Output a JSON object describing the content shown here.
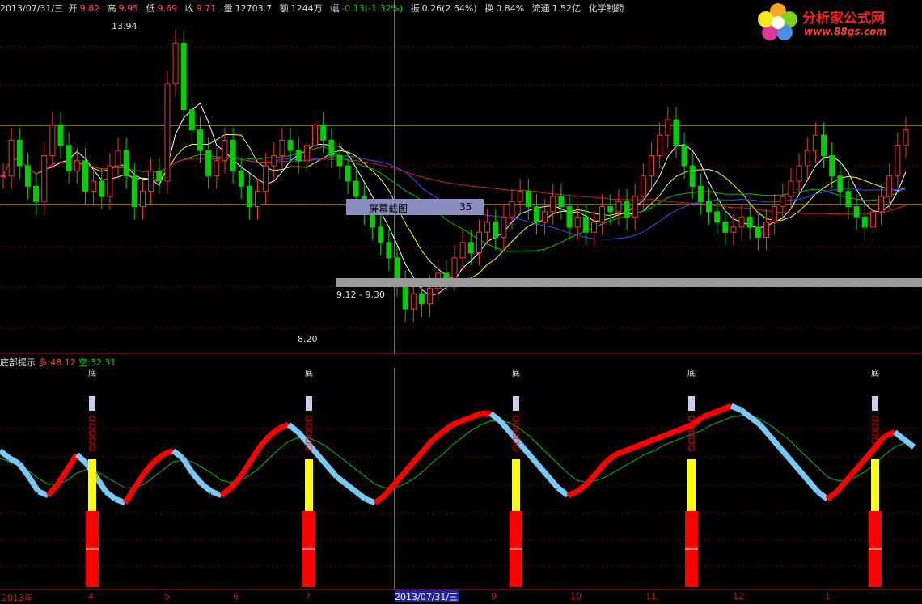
{
  "header": {
    "date": "2013/07/31/三",
    "open_label": "开",
    "open": "9.82",
    "high_label": "高",
    "high": "9.95",
    "low_label": "低",
    "low": "9.69",
    "close_label": "收",
    "close": "9.71",
    "vol_label": "量",
    "vol": "12703.7",
    "amt_label": "额",
    "amt": "1244万",
    "chg_label": "幅",
    "chg": "-0.13(-1.32%)",
    "amp_label": "振",
    "amp": "0.26(2.64%)",
    "turn_label": "换",
    "turn": "0.84%",
    "float_label": "流通",
    "float": "1.52亿",
    "sector": "化学制药"
  },
  "logo": {
    "title": "分析家公式网",
    "url": "www.88gs.com"
  },
  "tooltip": {
    "label": "屏幕截图",
    "value": "35"
  },
  "indicator": {
    "name": "底部提示",
    "long_label": "多:",
    "long_value": "48.12",
    "short_label": "空:",
    "short_value": "32.31",
    "marker": "底"
  },
  "colors": {
    "up": "#ff3232",
    "down": "#00d000",
    "ma5": "#ffffff",
    "ma10": "#ffff00",
    "ma20": "#00c000",
    "ma30": "#3050ff",
    "ma60": "#d02020",
    "rise": "#ff0000",
    "fall": "#7ac8f5",
    "signal": "#00c000",
    "yellow": "#ffff00",
    "grid": "#800000"
  },
  "chart_data": {
    "type": "candlestick",
    "ylim": [
      8.0,
      14.2
    ],
    "annotations": [
      {
        "text": "13.94",
        "value": 13.94
      },
      {
        "text": "8.20",
        "value": 8.2
      },
      {
        "text": "9.12 - 9.30",
        "value": 9.3
      }
    ],
    "x_ticks": [
      "2013年",
      "4",
      "5",
      "6",
      "7",
      "2013/07/31/三",
      "9",
      "10",
      "11",
      "12",
      "1"
    ],
    "candle_closes": [
      11.2,
      11.9,
      11.4,
      11.0,
      10.7,
      11.6,
      12.2,
      11.8,
      11.3,
      11.5,
      10.9,
      11.1,
      10.8,
      11.4,
      11.7,
      11.2,
      10.6,
      10.9,
      11.3,
      11.1,
      13.0,
      13.8,
      12.5,
      12.1,
      11.7,
      11.2,
      11.5,
      11.9,
      11.3,
      11.0,
      10.6,
      10.9,
      11.4,
      11.6,
      11.9,
      11.7,
      11.5,
      11.8,
      12.2,
      11.9,
      11.6,
      11.4,
      11.1,
      10.8,
      10.5,
      10.2,
      9.9,
      9.6,
      9.1,
      8.6,
      8.9,
      8.7,
      9.0,
      9.3,
      9.2,
      9.6,
      9.9,
      9.7,
      10.1,
      10.3,
      10.0,
      10.4,
      10.7,
      10.9,
      10.6,
      10.3,
      10.5,
      10.8,
      10.6,
      10.2,
      10.4,
      10.1,
      10.3,
      10.6,
      10.5,
      10.7,
      10.4,
      10.8,
      11.2,
      11.6,
      12.0,
      12.3,
      11.8,
      11.4,
      11.0,
      10.7,
      10.5,
      10.3,
      10.1,
      10.2,
      10.4,
      10.2,
      10.0,
      10.3,
      10.6,
      10.8,
      11.1,
      11.4,
      11.7,
      12.0,
      11.6,
      11.2,
      10.9,
      10.6,
      10.4,
      10.2,
      10.5,
      10.8,
      11.2,
      11.8,
      12.1
    ],
    "kd_long": [
      62,
      58,
      55,
      48,
      40,
      38,
      44,
      52,
      60,
      55,
      48,
      40,
      36,
      34,
      42,
      50,
      56,
      60,
      62,
      58,
      50,
      44,
      40,
      38,
      42,
      48,
      56,
      64,
      70,
      74,
      76,
      72,
      66,
      60,
      54,
      48,
      44,
      40,
      36,
      34,
      38,
      44,
      50,
      56,
      62,
      68,
      72,
      76,
      78,
      80,
      82,
      82,
      78,
      72,
      66,
      60,
      54,
      48,
      42,
      38,
      40,
      44,
      50,
      56,
      60,
      62,
      64,
      66,
      68,
      70,
      72,
      74,
      76,
      80,
      82,
      84,
      86,
      84,
      80,
      76,
      70,
      64,
      58,
      52,
      46,
      40,
      36,
      40,
      46,
      52,
      58,
      64,
      70,
      72,
      68,
      64
    ],
    "kd_signal": [
      58,
      56,
      54,
      51,
      47,
      44,
      44,
      46,
      50,
      52,
      51,
      48,
      45,
      42,
      42,
      44,
      48,
      52,
      56,
      57,
      56,
      53,
      50,
      46,
      45,
      46,
      49,
      53,
      58,
      63,
      67,
      69,
      69,
      67,
      64,
      60,
      56,
      52,
      48,
      44,
      42,
      42,
      44,
      47,
      51,
      56,
      60,
      65,
      69,
      73,
      76,
      78,
      78,
      77,
      74,
      70,
      65,
      60,
      55,
      50,
      46,
      45,
      46,
      48,
      51,
      54,
      57,
      60,
      62,
      65,
      67,
      69,
      71,
      73,
      76,
      78,
      80,
      81,
      81,
      79,
      76,
      72,
      68,
      63,
      58,
      53,
      48,
      46,
      46,
      48,
      51,
      55,
      60,
      64,
      66,
      66
    ]
  }
}
